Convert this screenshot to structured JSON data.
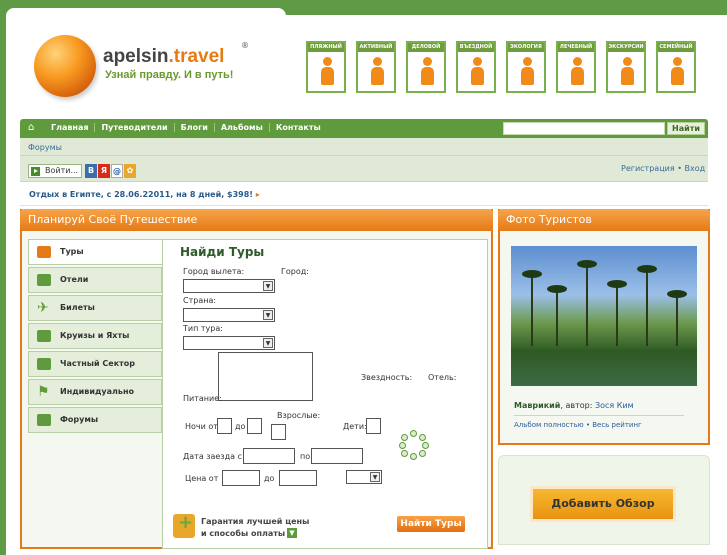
{
  "brand": {
    "name_main": "apelsin",
    "name_dot": ".travel",
    "reg": "®",
    "slogan": "Узнай правду. И в путь!"
  },
  "categories": [
    {
      "label": "ПЛЯЖНЫЙ",
      "icon": "beach-person-icon"
    },
    {
      "label": "АКТИВНЫЙ",
      "icon": "hiker-icon"
    },
    {
      "label": "ДЕЛОВОЙ",
      "icon": "business-icon"
    },
    {
      "label": "ВЪЕЗДНОЙ",
      "icon": "luggage-icon"
    },
    {
      "label": "ЭКОЛОГИЯ",
      "icon": "ecology-icon"
    },
    {
      "label": "ЛЕЧЕБНЫЙ",
      "icon": "medical-icon"
    },
    {
      "label": "ЭКСКУРСИИ",
      "icon": "excursion-icon"
    },
    {
      "label": "СЕМЕЙНЫЙ",
      "icon": "family-icon"
    }
  ],
  "nav": {
    "items": [
      "Главная",
      "Путеводители",
      "Блоги",
      "Альбомы",
      "Контакты"
    ],
    "search_placeholder": "",
    "search_button": "Найти"
  },
  "breadcrumb": "Форумы",
  "login": {
    "label": "Войти...",
    "social": [
      "В",
      "Я",
      "@",
      "✿"
    ],
    "register": "Регистрация",
    "sep": "•",
    "enter": "Вход"
  },
  "promo": "Отдых в Египте, с 28.06.22011, на 8 дней, $398!",
  "planner": {
    "title": "Планируй Своё Путешествие",
    "tabs": [
      "Туры",
      "Отели",
      "Билеты",
      "Круизы и Яхты",
      "Частный Сектор",
      "Индивидуально",
      "Форумы"
    ],
    "form": {
      "title": "Найди Туры",
      "city_from": "Город вылета:",
      "city": "Город:",
      "country": "Страна:",
      "tour_type": "Тип тура:",
      "stars": "Звездность:",
      "hotel": "Отель:",
      "food": "Питание:",
      "nights_from": "Ночи от",
      "nights_to": "до",
      "adults": "Взрослые:",
      "kids": "Дети:",
      "date_from": "Дата заезда с",
      "date_to": "по",
      "price_from": "Цена  от",
      "price_to": "до",
      "guarantee_line1": "Гарантия лучшей цены",
      "guarantee_line2": "и способы оплаты",
      "submit": "Найти Туры"
    }
  },
  "photos": {
    "title": "Фото Туристов",
    "place": "Маврикий",
    "author_prefix": ", автор:",
    "author": "Зося Ким",
    "links": "Альбом полностью • Весь рейтинг"
  },
  "review_button": "Добавить Обзор",
  "colors": {
    "green": "#5f9a45",
    "orange": "#e57a16",
    "link": "#2a5a9a"
  }
}
